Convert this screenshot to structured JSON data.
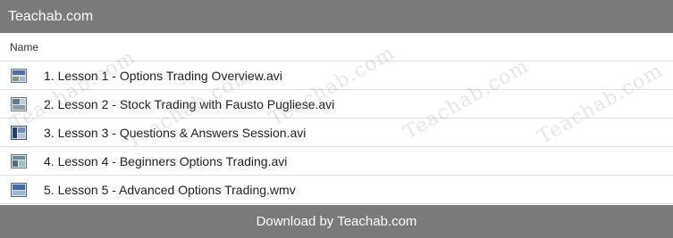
{
  "header": {
    "title": "Teachab.com"
  },
  "list": {
    "column_name": "Name",
    "files": [
      {
        "name": "1. Lesson 1 - Options Trading Overview.avi",
        "icon": "video-file-icon"
      },
      {
        "name": "2. Lesson 2 - Stock Trading with Fausto Pugliese.avi",
        "icon": "video-file-icon"
      },
      {
        "name": "3. Lesson 3 - Questions & Answers Session.avi",
        "icon": "video-file-icon"
      },
      {
        "name": "4. Lesson 4 - Beginners Options Trading.avi",
        "icon": "video-file-icon"
      },
      {
        "name": "5. Lesson 5 - Advanced Options Trading.wmv",
        "icon": "video-file-icon"
      }
    ]
  },
  "watermark": {
    "text": "Teachab.com"
  },
  "footer": {
    "label": "Download by Teachab.com"
  },
  "colors": {
    "bar": "#7a7a7a",
    "divider": "#dddddd"
  }
}
